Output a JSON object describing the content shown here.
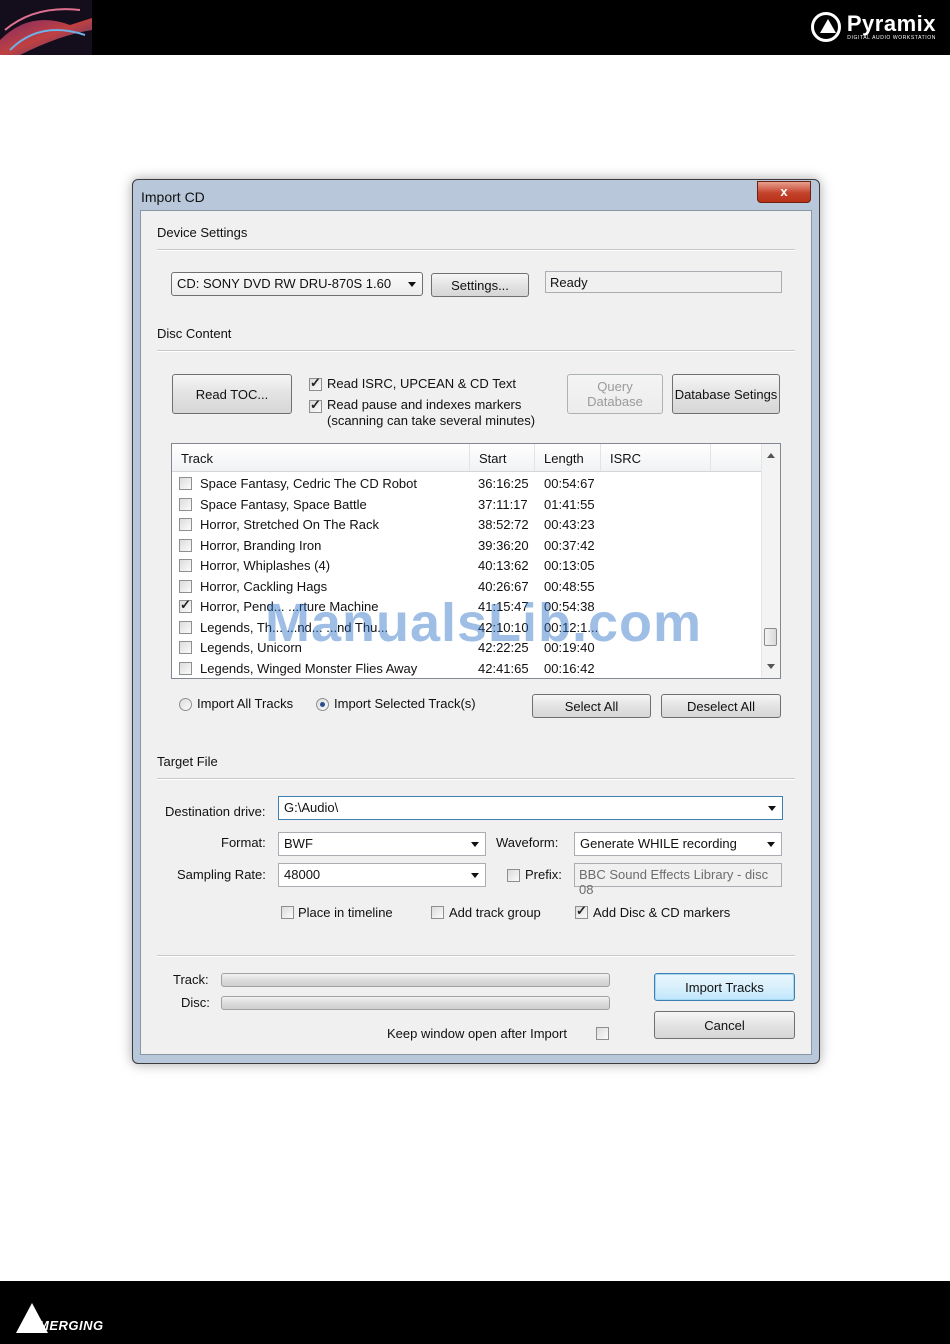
{
  "brand": {
    "name": "Pyramix",
    "subtitle": "DIGITAL AUDIO WORKSTATION",
    "footer": "MERGING"
  },
  "dialog": {
    "title": "Import CD",
    "close_label": "x",
    "device": {
      "section": "Device Settings",
      "drive": "CD: SONY DVD RW DRU-870S 1.60",
      "settings_button": "Settings...",
      "status": "Ready"
    },
    "disc": {
      "section": "Disc Content",
      "read_toc_button": "Read TOC...",
      "opt_isrc": {
        "label": "Read ISRC, UPCEAN & CD Text",
        "checked": true
      },
      "opt_pause": {
        "label": "Read pause and indexes markers",
        "checked": true,
        "note": "(scanning can take several minutes)"
      },
      "query_button": "Query Database",
      "dbsettings_button": "Database Setings",
      "columns": [
        "Track",
        "Start",
        "Length",
        "ISRC"
      ],
      "tracks": [
        {
          "name": "Space Fantasy, Cedric The CD Robot",
          "start": "36:16:25",
          "length": "00:54:67",
          "checked": false
        },
        {
          "name": "Space Fantasy, Space Battle",
          "start": "37:11:17",
          "length": "01:41:55",
          "checked": false
        },
        {
          "name": "Horror, Stretched On The Rack",
          "start": "38:52:72",
          "length": "00:43:23",
          "checked": false
        },
        {
          "name": "Horror, Branding Iron",
          "start": "39:36:20",
          "length": "00:37:42",
          "checked": false
        },
        {
          "name": "Horror, Whiplashes (4)",
          "start": "40:13:62",
          "length": "00:13:05",
          "checked": false
        },
        {
          "name": "Horror, Cackling Hags",
          "start": "40:26:67",
          "length": "00:48:55",
          "checked": false
        },
        {
          "name": "Horror, Pend... ...rture Machine",
          "start": "41:15:47",
          "length": "00:54:38",
          "checked": true
        },
        {
          "name": "Legends, Th... ...nd... ...nd Thu...",
          "start": "42:10:10",
          "length": "00:12:1...",
          "checked": false
        },
        {
          "name": "Legends, Unicorn",
          "start": "42:22:25",
          "length": "00:19:40",
          "checked": false
        },
        {
          "name": "Legends, Winged Monster Flies Away",
          "start": "42:41:65",
          "length": "00:16:42",
          "checked": false
        }
      ],
      "import_all_label": "Import All Tracks",
      "import_selected_label": "Import Selected Track(s)",
      "select_all_button": "Select All",
      "deselect_all_button": "Deselect All"
    },
    "target": {
      "section": "Target File",
      "dest_label": "Destination drive:",
      "dest_value": "G:\\Audio\\",
      "format_label": "Format:",
      "format_value": "BWF",
      "waveform_label": "Waveform:",
      "waveform_value": "Generate WHILE recording",
      "rate_label": "Sampling Rate:",
      "rate_value": "48000",
      "prefix_label": "Prefix:",
      "prefix_value": "BBC Sound Effects Library - disc 08",
      "place_timeline": {
        "label": "Place in timeline",
        "checked": false
      },
      "add_track_group": {
        "label": "Add track group",
        "checked": false
      },
      "add_markers": {
        "label": "Add Disc & CD markers",
        "checked": true
      }
    },
    "progress": {
      "track_label": "Track:",
      "disc_label": "Disc:",
      "track_fraction": 0,
      "disc_fraction": 0,
      "keep_open_label": "Keep window open after Import",
      "import_button": "Import Tracks",
      "cancel_button": "Cancel"
    }
  },
  "watermark": "ManualsLib.com"
}
